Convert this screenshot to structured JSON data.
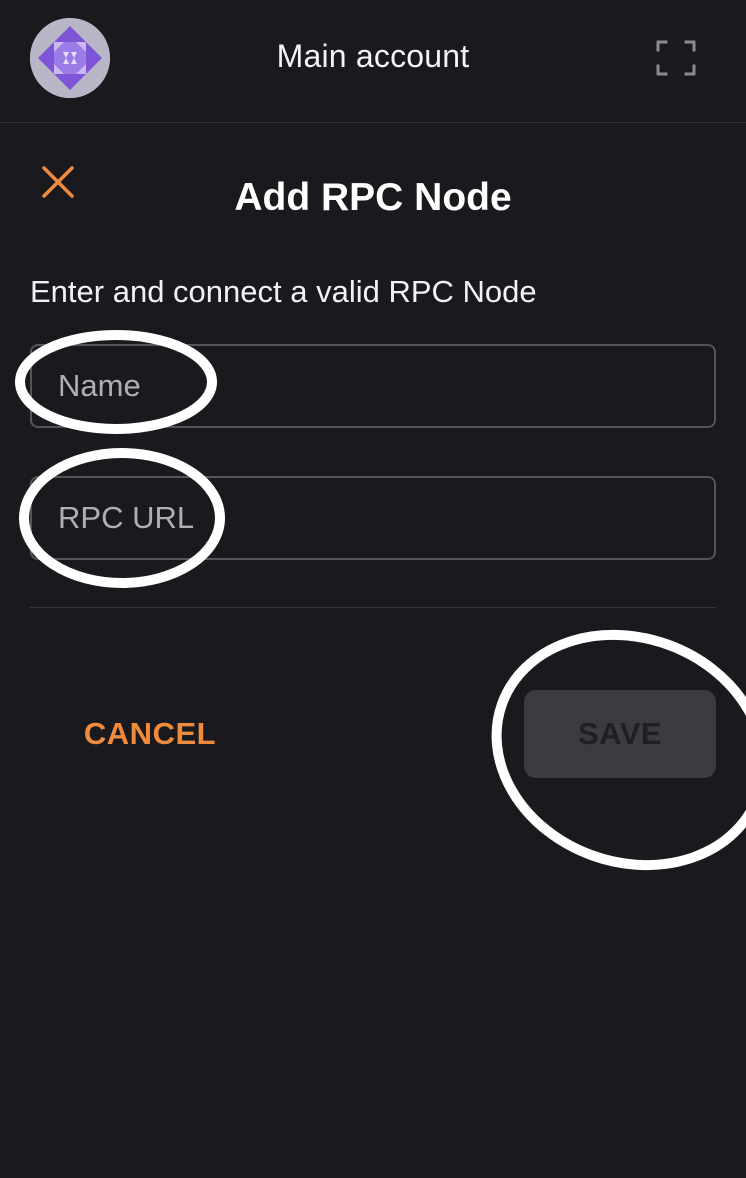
{
  "header": {
    "account_name": "Main account",
    "avatar_icon": "identicon-avatar",
    "expand_icon": "expand-corners-icon"
  },
  "dialog": {
    "close_icon": "close-icon",
    "title": "Add RPC Node",
    "subtitle": "Enter and connect a valid RPC Node",
    "name_field": {
      "value": "",
      "placeholder": "Name"
    },
    "url_field": {
      "value": "",
      "placeholder": "RPC URL"
    },
    "cancel_label": "CANCEL",
    "save_label": "SAVE",
    "save_enabled": false
  },
  "colors": {
    "background": "#19191e",
    "accent": "#f08a3c",
    "disabled_button": "#3b3b41",
    "field_border": "#55555c",
    "annotation": "#ffffff"
  }
}
